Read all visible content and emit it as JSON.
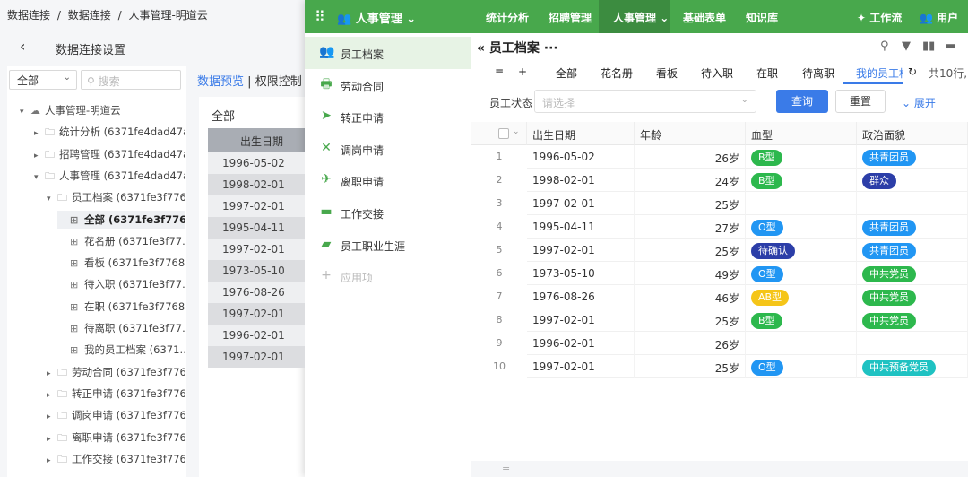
{
  "breadcrumb": [
    "数据连接",
    "/",
    "数据连接",
    "/",
    "人事管理-明道云"
  ],
  "settings_title": "数据连接设置",
  "left": {
    "scope_value": "全部",
    "search_placeholder": "搜索",
    "tree": [
      {
        "label": "人事管理-明道云",
        "depth": 0,
        "caret": "▾",
        "icon": "cloud"
      },
      {
        "label": "统计分析 (6371fe4dad47a…",
        "depth": 1,
        "caret": "▸",
        "icon": "folder"
      },
      {
        "label": "招聘管理 (6371fe4dad47a…",
        "depth": 1,
        "caret": "▸",
        "icon": "folder"
      },
      {
        "label": "人事管理 (6371fe4dad47a…",
        "depth": 1,
        "caret": "▾",
        "icon": "folder"
      },
      {
        "label": "员工档案 (6371fe3f776…",
        "depth": 2,
        "caret": "▾",
        "icon": "folder"
      },
      {
        "label": "全部 (6371fe3f776…",
        "depth": 3,
        "caret": "",
        "icon": "table",
        "selected": true
      },
      {
        "label": "花名册 (6371fe3f77…",
        "depth": 3,
        "caret": "",
        "icon": "table"
      },
      {
        "label": "看板 (6371fe3f7768…",
        "depth": 3,
        "caret": "",
        "icon": "table"
      },
      {
        "label": "待入职 (6371fe3f77…",
        "depth": 3,
        "caret": "",
        "icon": "table"
      },
      {
        "label": "在职 (6371fe3f7768…",
        "depth": 3,
        "caret": "",
        "icon": "table"
      },
      {
        "label": "待离职 (6371fe3f77…",
        "depth": 3,
        "caret": "",
        "icon": "table"
      },
      {
        "label": "我的员工档案 (6371…",
        "depth": 3,
        "caret": "",
        "icon": "table"
      },
      {
        "label": "劳动合同 (6371fe3f776…",
        "depth": 2,
        "caret": "▸",
        "icon": "folder"
      },
      {
        "label": "转正申请 (6371fe3f776…",
        "depth": 2,
        "caret": "▸",
        "icon": "folder"
      },
      {
        "label": "调岗申请 (6371fe3f776…",
        "depth": 2,
        "caret": "▸",
        "icon": "folder"
      },
      {
        "label": "离职申请 (6371fe3f776…",
        "depth": 2,
        "caret": "▸",
        "icon": "folder"
      },
      {
        "label": "工作交接 (6371fe3f776…",
        "depth": 2,
        "caret": "▸",
        "icon": "folder"
      }
    ]
  },
  "preview": {
    "tab_preview": "数据预览",
    "tab_sep": "|",
    "tab_permission": "权限控制",
    "all_label": "全部",
    "column_header": "出生日期",
    "dates": [
      "1996-05-02",
      "1998-02-01",
      "1997-02-01",
      "1995-04-11",
      "1997-02-01",
      "1973-05-10",
      "1976-08-26",
      "1997-02-01",
      "1996-02-01",
      "1997-02-01"
    ]
  },
  "app": {
    "title": "人事管理",
    "nav": [
      "统计分析",
      "招聘管理",
      "人事管理",
      "基础表单",
      "知识库"
    ],
    "workflow": "工作流",
    "users": "用户",
    "sidebar": [
      {
        "label": "员工档案",
        "icon": "users-icon",
        "active": true
      },
      {
        "label": "劳动合同",
        "icon": "printer-icon"
      },
      {
        "label": "转正申请",
        "icon": "send-icon"
      },
      {
        "label": "调岗申请",
        "icon": "tools-icon"
      },
      {
        "label": "离职申请",
        "icon": "plane-icon"
      },
      {
        "label": "工作交接",
        "icon": "briefcase-icon"
      },
      {
        "label": "员工职业生涯",
        "icon": "truck-icon"
      },
      {
        "label": "应用项",
        "icon": "plus-icon",
        "muted": true
      }
    ],
    "form_title": "员工档案",
    "view_tabs": [
      "全部",
      "花名册",
      "看板",
      "待入职",
      "在职",
      "待离职",
      "我的员工档"
    ],
    "count_text": "共10行,",
    "filter_label": "员工状态",
    "filter_placeholder": "请选择",
    "query_label": "查询",
    "reset_label": "重置",
    "expand_label": "展开",
    "columns": [
      "出生日期",
      "年龄",
      "血型",
      "政治面貌"
    ],
    "rows": [
      {
        "n": "1",
        "date": "1996-05-02",
        "age": "26岁",
        "blood": "B型",
        "blood_color": "#2db84d",
        "pol": "共青团员",
        "pol_color": "#2196f3"
      },
      {
        "n": "2",
        "date": "1998-02-01",
        "age": "24岁",
        "blood": "B型",
        "blood_color": "#2db84d",
        "pol": "群众",
        "pol_color": "#2c3ea8"
      },
      {
        "n": "3",
        "date": "1997-02-01",
        "age": "25岁",
        "blood": "",
        "blood_color": "",
        "pol": "",
        "pol_color": ""
      },
      {
        "n": "4",
        "date": "1995-04-11",
        "age": "27岁",
        "blood": "O型",
        "blood_color": "#2196f3",
        "pol": "共青团员",
        "pol_color": "#2196f3"
      },
      {
        "n": "5",
        "date": "1997-02-01",
        "age": "25岁",
        "blood": "待确认",
        "blood_color": "#2c3ea8",
        "pol": "共青团员",
        "pol_color": "#2196f3"
      },
      {
        "n": "6",
        "date": "1973-05-10",
        "age": "49岁",
        "blood": "O型",
        "blood_color": "#2196f3",
        "pol": "中共党员",
        "pol_color": "#2db84d"
      },
      {
        "n": "7",
        "date": "1976-08-26",
        "age": "46岁",
        "blood": "AB型",
        "blood_color": "#f5c518",
        "pol": "中共党员",
        "pol_color": "#2db84d"
      },
      {
        "n": "8",
        "date": "1997-02-01",
        "age": "25岁",
        "blood": "B型",
        "blood_color": "#2db84d",
        "pol": "中共党员",
        "pol_color": "#2db84d"
      },
      {
        "n": "9",
        "date": "1996-02-01",
        "age": "26岁",
        "blood": "",
        "blood_color": "",
        "pol": "",
        "pol_color": ""
      },
      {
        "n": "10",
        "date": "1997-02-01",
        "age": "25岁",
        "blood": "O型",
        "blood_color": "#2196f3",
        "pol": "中共预备党员",
        "pol_color": "#1fc2c2"
      }
    ],
    "footer": "="
  },
  "colors": {
    "green": "#48a84c",
    "green_dark": "#3c8c40",
    "blue": "#3a7be8"
  }
}
